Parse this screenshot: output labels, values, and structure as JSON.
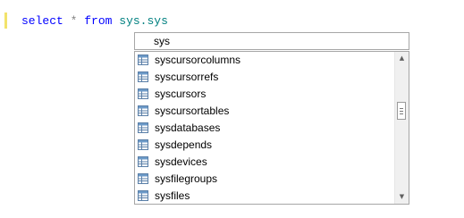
{
  "editor": {
    "code": {
      "keyword_select": "select",
      "operator_star": "*",
      "keyword_from": "from",
      "object_text": "sys.sys"
    }
  },
  "intellisense": {
    "filter_value": "sys",
    "items": [
      "syscursorcolumns",
      "syscursorrefs",
      "syscursors",
      "syscursortables",
      "sysdatabases",
      "sysdepends",
      "sysdevices",
      "sysfilegroups",
      "sysfiles"
    ],
    "item_icon": "table-icon",
    "colors": {
      "keyword": "#0000ff",
      "identifier": "#008080",
      "gutter_marker": "#f2e36b"
    }
  }
}
